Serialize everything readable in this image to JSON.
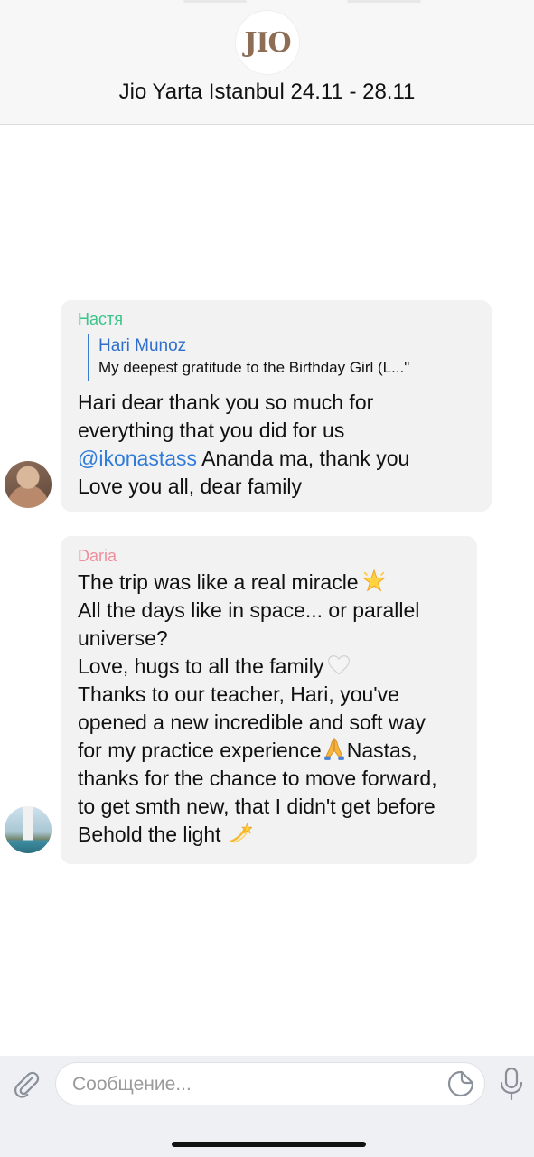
{
  "header": {
    "logo_text": "JIO",
    "title": "Jio Yarta Istanbul 24.11 - 28.11"
  },
  "messages": [
    {
      "sender": "Настя",
      "sender_color": "#3cc58b",
      "reply": {
        "name": "Hari Munoz",
        "text": "My deepest gratitude to the Birthday Girl (L...\""
      },
      "lines": [
        "Hari dear thank you so much for",
        "everything that you did for us",
        "Ananda ma, thank you",
        "Love you all, dear family"
      ],
      "mention": "@ikonastass"
    },
    {
      "sender": "Daria",
      "sender_color": "#ef8f9c",
      "lines": [
        "The trip was like a real miracle",
        "All the days like in space... or parallel",
        "universe?",
        "Love, hugs to all the family",
        "Thanks to our teacher, Hari, you've",
        "opened a new incredible and soft way",
        "for my practice experience",
        "Nastas,",
        "thanks for the chance to move forward,",
        "to get smth new, that I didn't get before",
        "Behold the light"
      ],
      "emojis": [
        "glowing-star",
        "white-heart",
        "folded-hands",
        "dizzy-symbol"
      ]
    }
  ],
  "composer": {
    "placeholder": "Сообщение...",
    "value": ""
  },
  "icons": {
    "attach": "paperclip-icon",
    "sticker": "sticker-icon",
    "mic": "microphone-icon"
  }
}
